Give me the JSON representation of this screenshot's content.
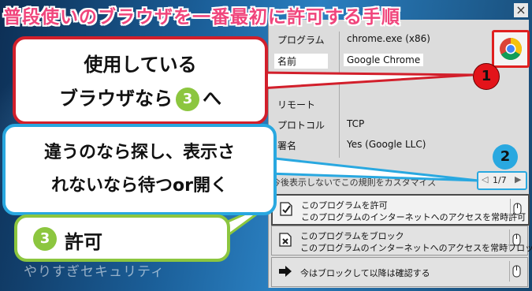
{
  "title": "普段使いのブラウザを一番最初に許可する手順",
  "close_label": "×",
  "info": {
    "program_label": "プログラム",
    "program_value": "chrome.exe (x86)",
    "name_label": "名前",
    "name_value": "Google Chrome",
    "remote_label": "リモート",
    "protocol_label": "プロトコル",
    "protocol_value": "TCP",
    "signature_label": "署名",
    "signature_value": "Yes (Google LLC)"
  },
  "hint_text": "今後表示しないでこの規則をカスタマイズ",
  "pager": {
    "prev": "◁",
    "page": "1/7",
    "next": "▶"
  },
  "actions": {
    "allow_title": "このプログラムを許可",
    "allow_sub": "このプログラムのインターネットへのアクセスを常時許可",
    "block_title": "このプログラムをブロック",
    "block_sub": "このプログラムのインターネットへのアクセスを常時ブロック",
    "confirm_title": "今はブロックして以降は確認する"
  },
  "callouts": {
    "c1_line1": "使用している",
    "c1_line2a": "ブラウザなら",
    "c1_num": "3",
    "c1_line2b": "へ",
    "c2_line1": "違うのなら探し、表示さ",
    "c2_line2": "れないなら待つor開く",
    "c3_num": "3",
    "c3_text": "許可"
  },
  "badges": {
    "one": "1",
    "two": "2"
  },
  "watermark": "やりすぎセキュリティ",
  "colors": {
    "title": "#f0457c",
    "red": "#d21f2b",
    "blue": "#29a8e0",
    "green": "#8cc63f"
  }
}
